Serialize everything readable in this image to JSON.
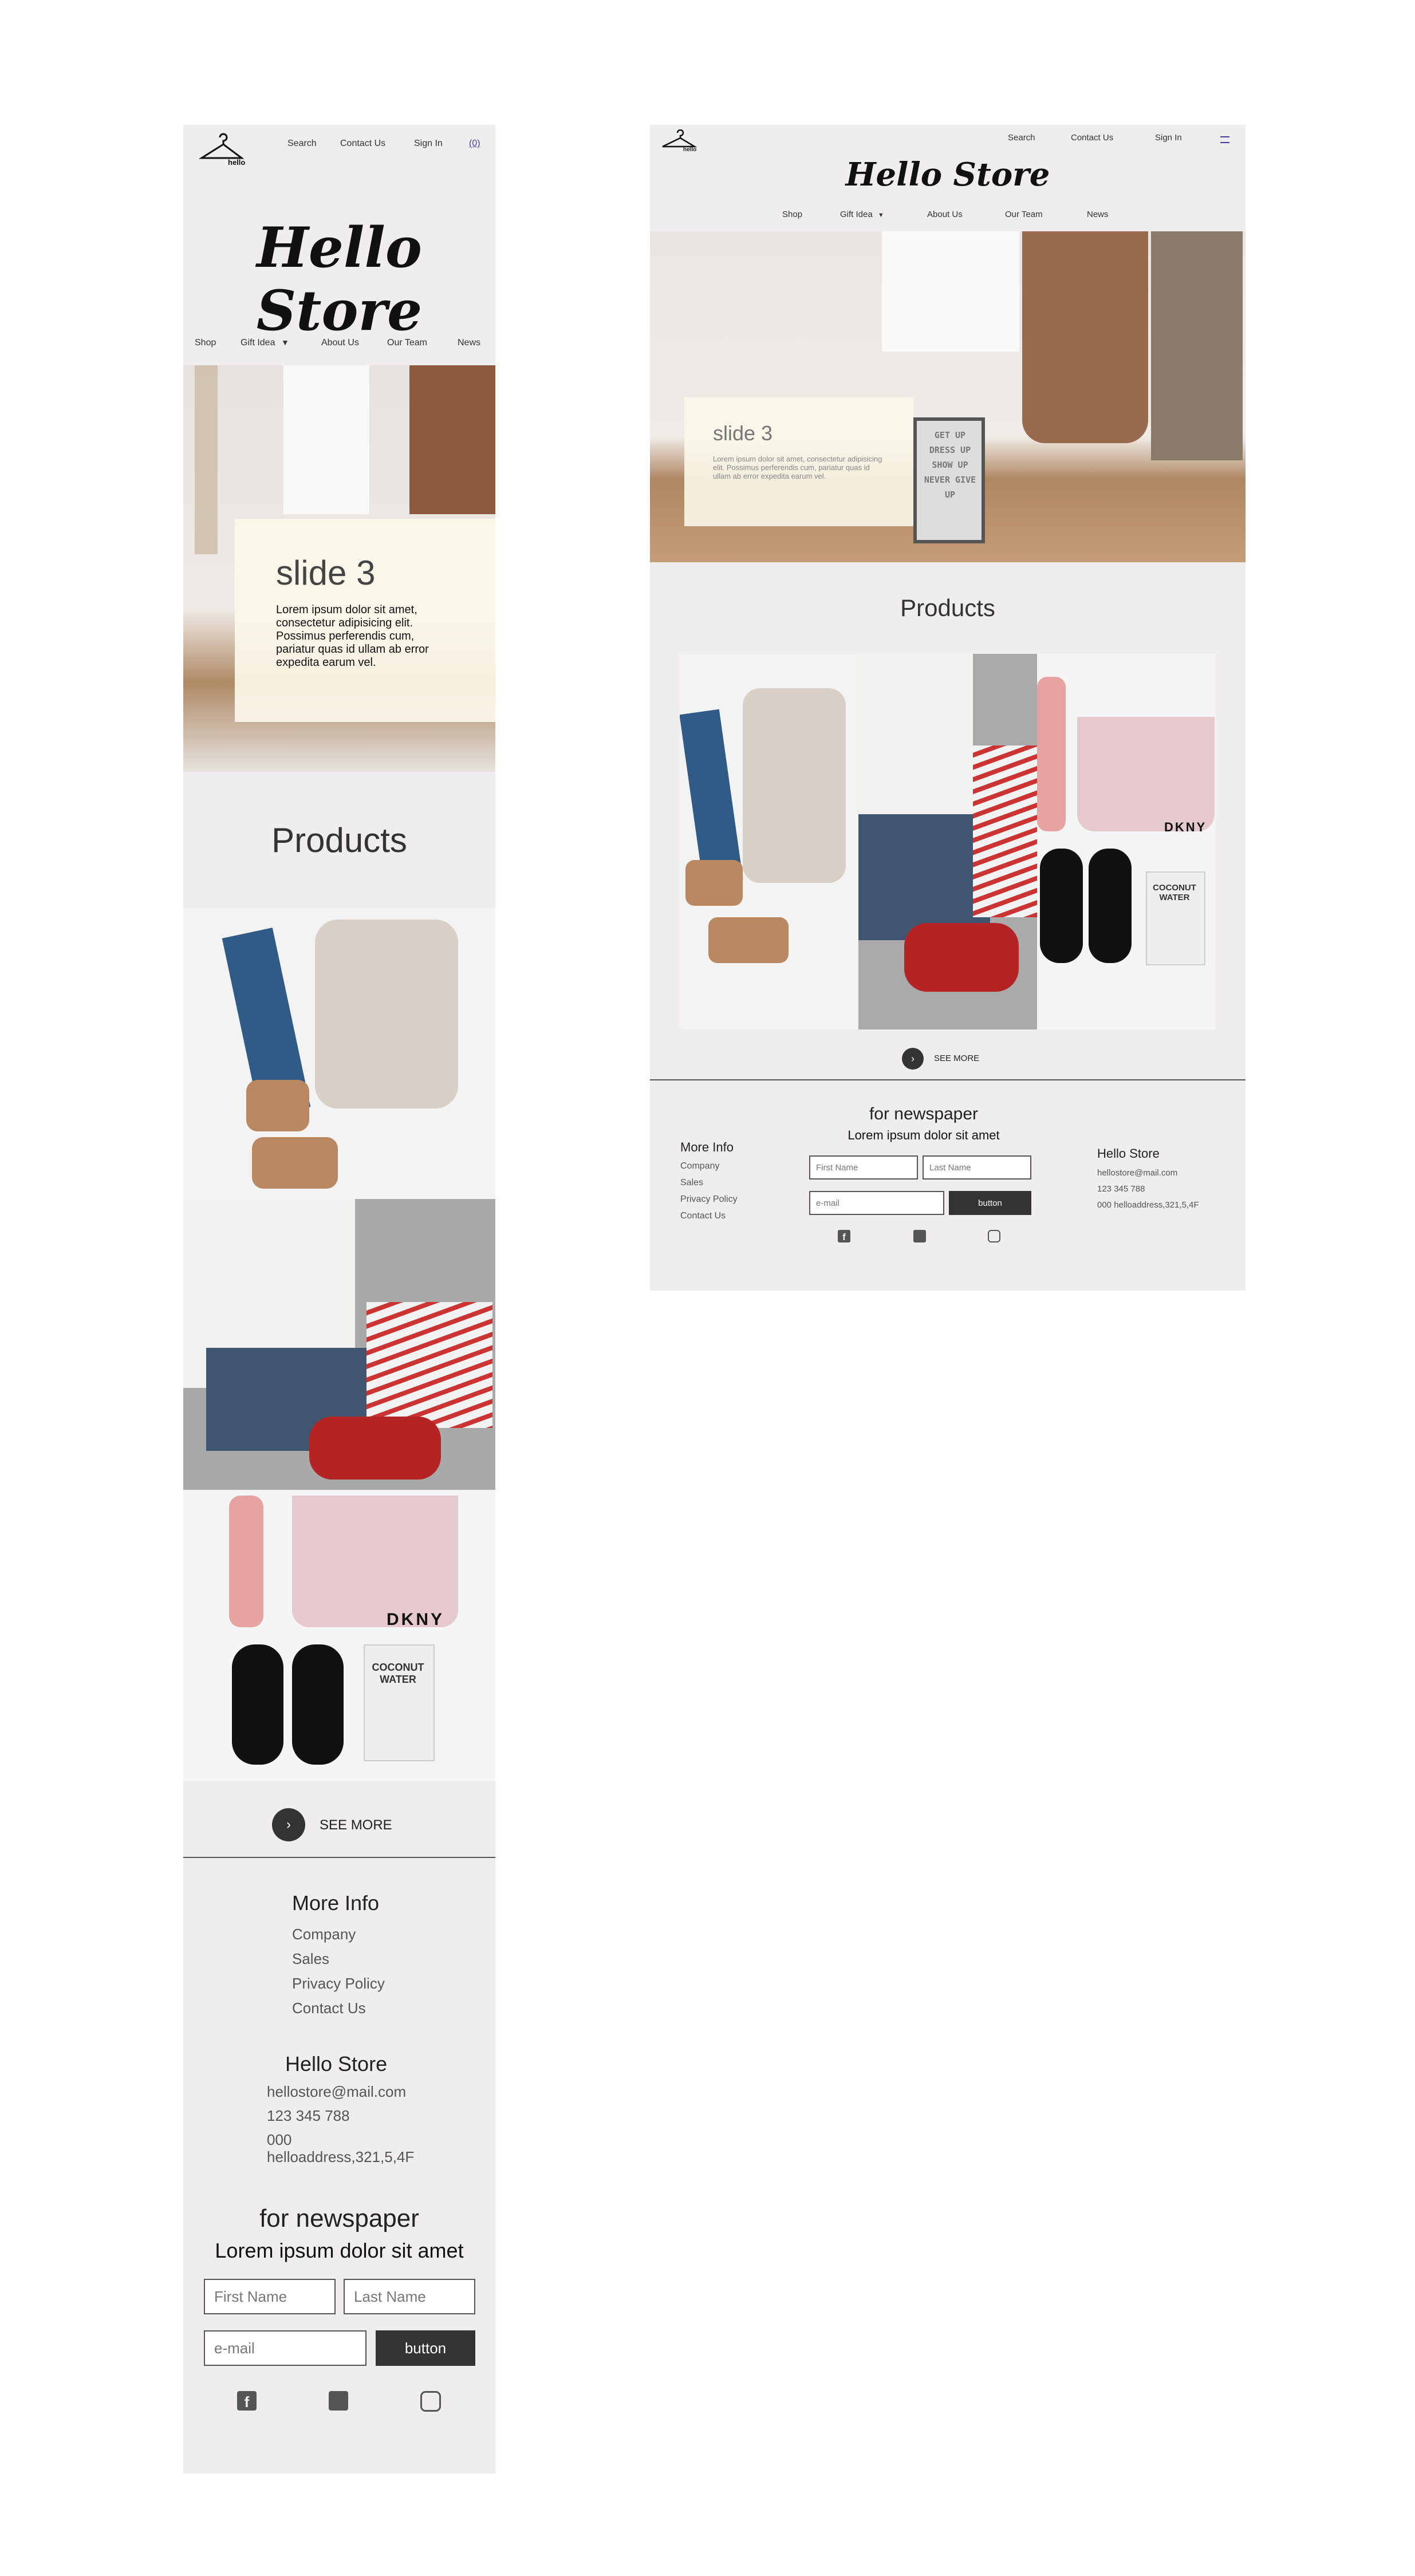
{
  "brand": {
    "title": "Hello Store",
    "logo_text": "hello"
  },
  "topnav": {
    "search": "Search",
    "contact": "Contact Us",
    "signin": "Sign In",
    "cart": "(0)"
  },
  "mainnav": {
    "shop": "Shop",
    "gift": "Gift Idea",
    "about": "About Us",
    "team": "Our Team",
    "news": "News"
  },
  "hero": {
    "slide_title": "slide 3",
    "slide_text": "Lorem ipsum dolor sit amet, consectetur adipisicing elit. Possimus perferendis cum, pariatur quas id ullam ab error expedita earum vel.",
    "poster_text": "GET UP DRESS UP SHOW UP NEVER GIVE UP"
  },
  "products": {
    "title": "Products",
    "see_more": "SEE MORE",
    "brand_label": "DKNY",
    "can_label": "COCONUT WATER"
  },
  "footer": {
    "more_info_title": "More Info",
    "links": [
      "Company",
      "Sales",
      "Privacy Policy",
      "Contact Us"
    ],
    "store_title": "Hello Store",
    "email": "hellostore@mail.com",
    "phone": "123 345 788",
    "address": "000 helloaddress,321,5,4F",
    "newsletter_title": "for newspaper",
    "newsletter_sub": "Lorem ipsum dolor sit amet",
    "first_name_placeholder": "First Name",
    "last_name_placeholder": "Last Name",
    "email_placeholder": "e-mail",
    "button_label": "button"
  },
  "colors": {
    "panel": "#efeded",
    "dark": "#333333",
    "slide_box": "#fbf8ea"
  },
  "icons": [
    "hanger-icon",
    "chevron-down-icon",
    "chevron-right-icon",
    "facebook-icon",
    "twitter-icon",
    "instagram-icon"
  ]
}
